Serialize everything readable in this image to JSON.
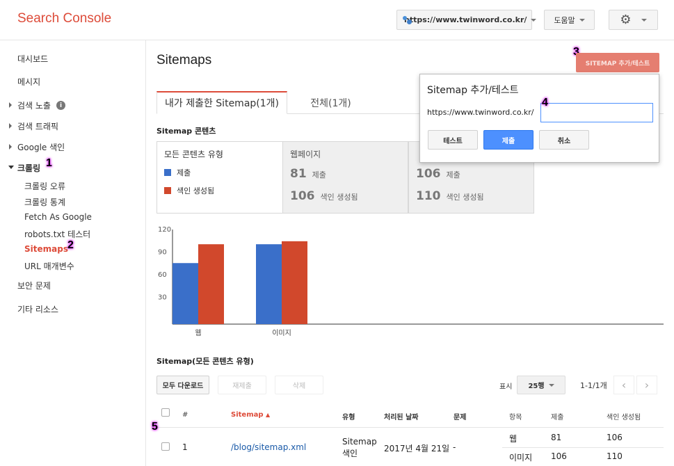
{
  "header": {
    "app_title": "Search Console",
    "site": "https://www.twinword.co.kr/",
    "help_label": "도움말",
    "settings_icon": "gear-icon"
  },
  "sidebar": {
    "items": [
      {
        "label": "대시보드"
      },
      {
        "label": "메시지"
      },
      {
        "label": "검색 노출"
      },
      {
        "label": "검색 트래픽"
      },
      {
        "label": "Google 색인"
      },
      {
        "label": "크롤링"
      },
      {
        "label": "보안 문제"
      },
      {
        "label": "기타 리소스"
      }
    ],
    "crawl_sub": [
      {
        "label": "크롤링 오류"
      },
      {
        "label": "크롤링 통계"
      },
      {
        "label": "Fetch As Google"
      },
      {
        "label": "robots.txt 테스터"
      },
      {
        "label": "Sitemaps"
      },
      {
        "label": "URL 매개변수"
      }
    ]
  },
  "markers": [
    "1",
    "2",
    "3",
    "4",
    "5"
  ],
  "main": {
    "title": "Sitemaps",
    "add_button": "SITEMAP 추가/테스트",
    "tabs": [
      {
        "label": "내가 제출한 Sitemap(1개)"
      },
      {
        "label": "전체(1개)"
      }
    ],
    "content_label": "Sitemap 콘텐츠",
    "summary": {
      "all_types_label": "모든 콘텐츠 유형",
      "legend_submitted": "제출",
      "legend_indexed": "색인 생성됨",
      "web_head": "웹페이지",
      "web_submitted": "81",
      "web_indexed": "106",
      "img_submitted": "106",
      "img_indexed": "110",
      "submitted_label": "제출",
      "indexed_label": "색인 생성됨"
    },
    "list_label": "Sitemap(모든 콘텐츠 유형)",
    "toolbar": {
      "download_all": "모두 다운로드",
      "resubmit": "재제출",
      "delete": "삭제",
      "show_label": "표시",
      "rows": "25행",
      "page_info": "1-1/1개"
    },
    "table": {
      "headers": {
        "num": "#",
        "sitemap": "Sitemap",
        "type": "유형",
        "processed": "처리된 날짜",
        "issues": "문제",
        "item": "항목",
        "submitted": "제출",
        "indexed": "색인 생성됨"
      },
      "rows": [
        {
          "num": "1",
          "sitemap": "/blog/sitemap.xml",
          "type_line1": "Sitemap",
          "type_line2": "색인",
          "processed": "2017년 4월 21일",
          "issues": "-",
          "sub": [
            {
              "item": "웹",
              "submitted": "81",
              "indexed": "106"
            },
            {
              "item": "이미지",
              "submitted": "106",
              "indexed": "110"
            }
          ]
        }
      ]
    }
  },
  "dialog": {
    "title": "Sitemap 추가/테스트",
    "prefix": "https://www.twinword.co.kr/",
    "input_value": "",
    "test_label": "테스트",
    "submit_label": "제출",
    "cancel_label": "취소"
  },
  "colors": {
    "submitted": "#3a6fc9",
    "indexed": "#d1482c",
    "accent": "#dd4b39"
  },
  "chart_data": {
    "type": "bar",
    "categories": [
      "웹",
      "이미지"
    ],
    "series": [
      {
        "name": "제출",
        "values": [
          81,
          106
        ]
      },
      {
        "name": "색인 생성됨",
        "values": [
          106,
          110
        ]
      }
    ],
    "yticks": [
      "30",
      "60",
      "90",
      "120"
    ],
    "ylim": [
      0,
      120
    ],
    "grid": false
  }
}
